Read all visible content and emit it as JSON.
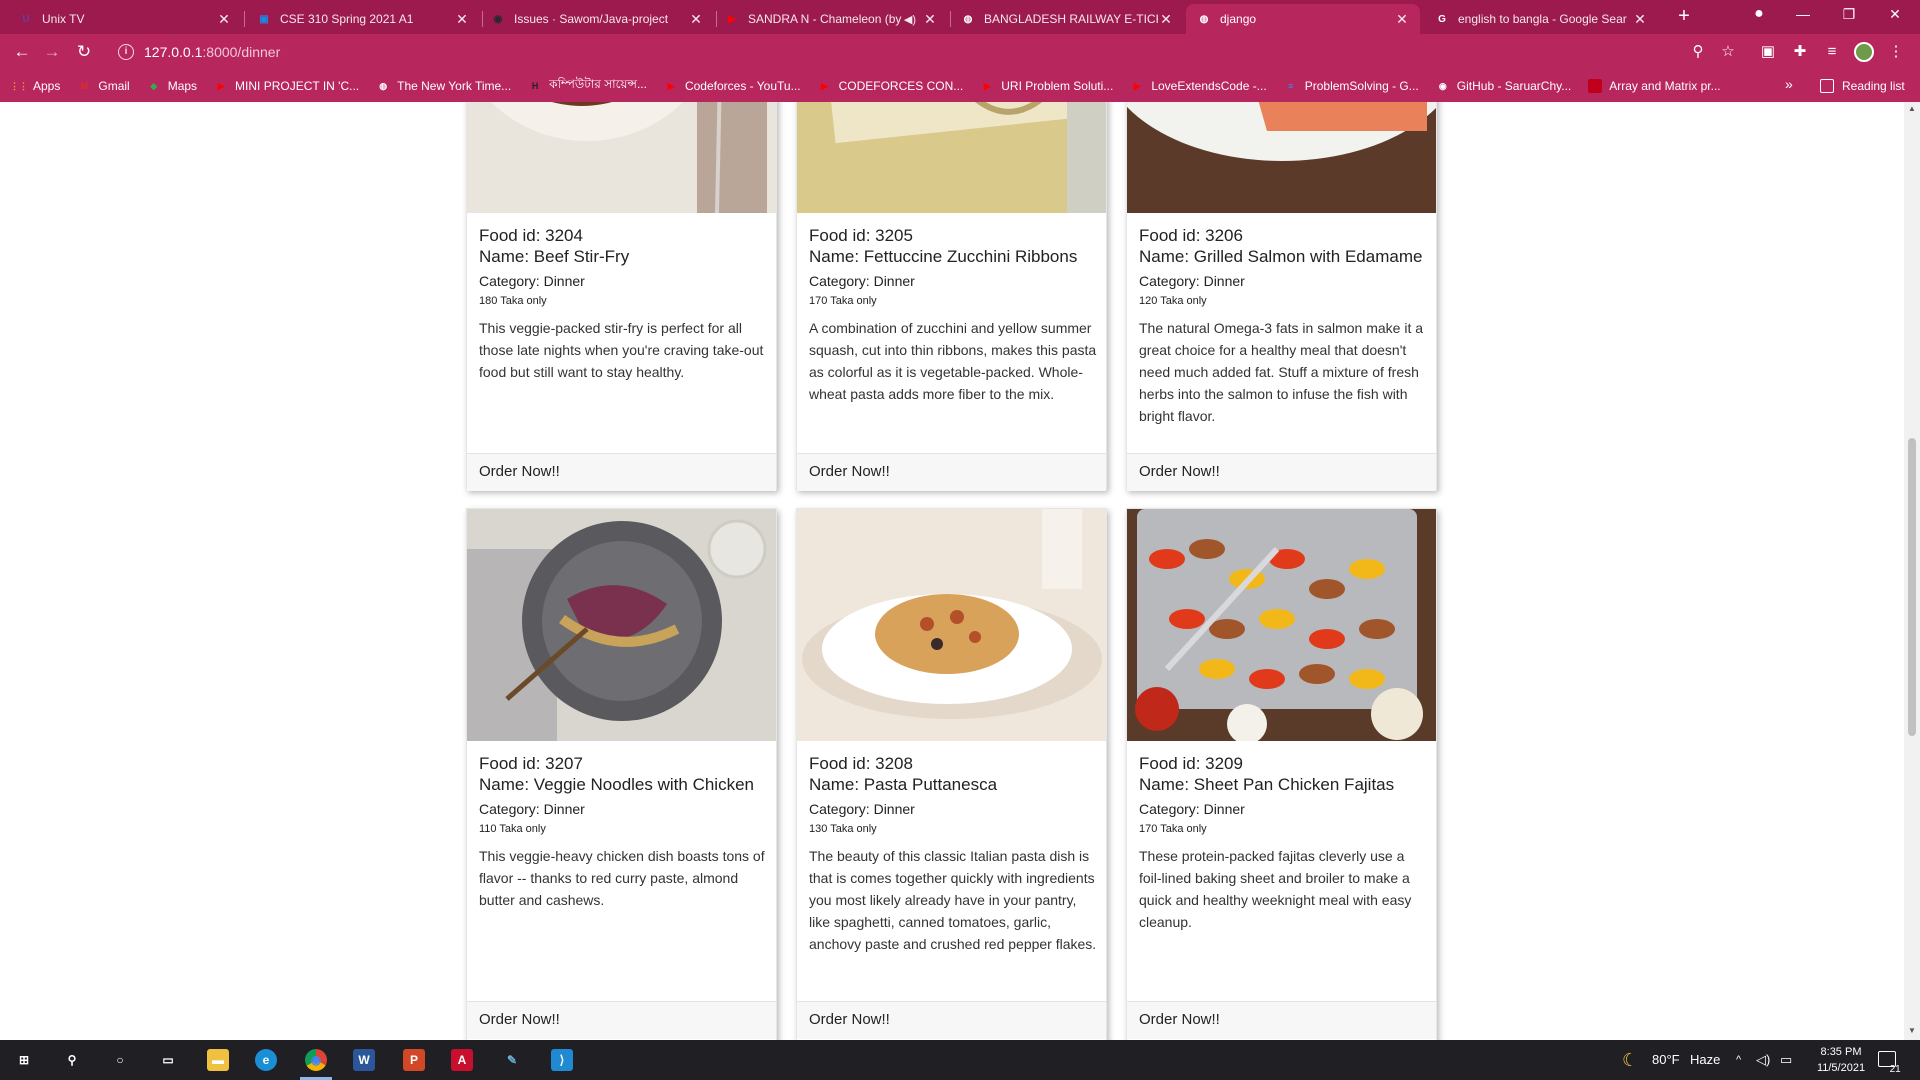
{
  "browser": {
    "tabs": [
      {
        "title": "Unix TV",
        "icon": "unix-tv-favicon",
        "icon_color": "#6a3ea1",
        "glyph": "U",
        "active": false
      },
      {
        "title": "CSE 310 Spring 2021 A1",
        "icon": "classroom-favicon",
        "icon_color": "#1e88e5",
        "glyph": "▣",
        "active": false
      },
      {
        "title": "Issues · Sawom/Java-project",
        "icon": "github-favicon",
        "icon_color": "#24292e",
        "glyph": "◉",
        "active": false
      },
      {
        "title": "SANDRA N - Chameleon (by",
        "icon": "youtube-favicon",
        "icon_color": "#ff0000",
        "glyph": "▶",
        "active": false,
        "audio": true
      },
      {
        "title": "BANGLADESH RAILWAY E-TICKE",
        "icon": "globe-favicon",
        "icon_color": "#ffffff",
        "glyph": "◍",
        "active": false
      },
      {
        "title": "django",
        "icon": "globe-favicon",
        "icon_color": "#ffffff",
        "glyph": "◍",
        "active": true
      },
      {
        "title": "english to bangla - Google Sear",
        "icon": "google-favicon",
        "icon_color": "#ffffff",
        "glyph": "G",
        "active": false
      }
    ],
    "url_host": "127.0.0.1",
    "url_path": ":8000/dinner",
    "bookmarks": [
      {
        "label": "Apps",
        "icon": "apps-grid-icon",
        "color": "#f0a030",
        "glyph": "⋮⋮"
      },
      {
        "label": "Gmail",
        "icon": "gmail-icon",
        "color": "#d93025",
        "glyph": "M"
      },
      {
        "label": "Maps",
        "icon": "maps-icon",
        "color": "#34a853",
        "glyph": "◆"
      },
      {
        "label": "MINI PROJECT IN 'C...",
        "icon": "youtube-icon",
        "color": "#ff0000",
        "glyph": "▶"
      },
      {
        "label": "The New York Time...",
        "icon": "globe-icon",
        "color": "#ffffff",
        "glyph": "◍"
      },
      {
        "label": "কম্পিউটার সায়েন্স...",
        "icon": "bookmark-site-icon",
        "color": "#222222",
        "glyph": "H"
      },
      {
        "label": "Codeforces - YouTu...",
        "icon": "youtube-icon",
        "color": "#ff0000",
        "glyph": "▶"
      },
      {
        "label": "CODEFORCES CON...",
        "icon": "youtube-icon",
        "color": "#ff0000",
        "glyph": "▶"
      },
      {
        "label": "URI Problem Soluti...",
        "icon": "youtube-icon",
        "color": "#ff0000",
        "glyph": "▶"
      },
      {
        "label": "LoveExtendsCode -...",
        "icon": "youtube-icon",
        "color": "#ff0000",
        "glyph": "▶"
      },
      {
        "label": "ProblemSolving - G...",
        "icon": "google-docs-icon",
        "color": "#4285f4",
        "glyph": "≡"
      },
      {
        "label": "GitHub - SaruarChy...",
        "icon": "github-icon",
        "color": "#ffffff",
        "glyph": "◉"
      },
      {
        "label": "Array and Matrix pr...",
        "icon": "folder-icon",
        "color": "#c0001a",
        "glyph": ""
      }
    ],
    "more_label": "»",
    "reading_list": "Reading list"
  },
  "foods": [
    {
      "id_text": "Food id: 3204",
      "name_text": "Name: Beef Stir-Fry",
      "category_text": "Category: Dinner",
      "price_text": "180 Taka only",
      "description": "This veggie-packed stir-fry is perfect for all those late nights when you're craving take-out food but still want to stay healthy.",
      "order_label": "Order Now!!",
      "photo": "beef-stir-fry-photo",
      "colors": [
        "#6b3a22",
        "#d23a1f",
        "#3f7d2a",
        "#e8c45a"
      ]
    },
    {
      "id_text": "Food id: 3205",
      "name_text": "Name: Fettuccine Zucchini Ribbons",
      "category_text": "Category: Dinner",
      "price_text": "170 Taka only",
      "description": "A combination of zucchini and yellow summer squash, cut into thin ribbons, makes this pasta as colorful as it is vegetable-packed. Whole-wheat pasta adds more fiber to the mix.",
      "order_label": "Order Now!!",
      "photo": "zucchini-pasta-photo",
      "colors": [
        "#d9c98a",
        "#7a9a3a",
        "#efe6c8",
        "#b8a46a"
      ]
    },
    {
      "id_text": "Food id: 3206",
      "name_text": "Name: Grilled Salmon with Edamame",
      "category_text": "Category: Dinner",
      "price_text": "120 Taka only",
      "description": "The natural Omega-3 fats in salmon make it a great choice for a healthy meal that doesn't need much added fat. Stuff a mixture of fresh herbs into the salmon to infuse the fish with bright flavor.",
      "order_label": "Order Now!!",
      "photo": "grilled-salmon-photo",
      "colors": [
        "#5b3a2a",
        "#6fb13a",
        "#e9825a",
        "#f2f2ee"
      ]
    },
    {
      "id_text": "Food id: 3207",
      "name_text": "Name: Veggie Noodles with Chicken",
      "category_text": "Category: Dinner",
      "price_text": "110 Taka only",
      "description": "This veggie-heavy chicken dish boasts tons of flavor -- thanks to red curry paste, almond butter and cashews.",
      "order_label": "Order Now!!",
      "photo": "veggie-noodles-photo",
      "colors": [
        "#d9d6d0",
        "#5a5a5e",
        "#7a2a4a",
        "#c9a35a"
      ]
    },
    {
      "id_text": "Food id: 3208",
      "name_text": "Name: Pasta Puttanesca",
      "category_text": "Category: Dinner",
      "price_text": "130 Taka only",
      "description": "The beauty of this classic Italian pasta dish is that is comes together quickly with ingredients you most likely already have in your pantry, like spaghetti, canned tomatoes, garlic, anchovy paste and crushed red pepper flakes.",
      "order_label": "Order Now!!",
      "photo": "pasta-puttanesca-photo",
      "colors": [
        "#efe7dc",
        "#ffffff",
        "#b3502a",
        "#d8a25a"
      ]
    },
    {
      "id_text": "Food id: 3209",
      "name_text": "Name: Sheet Pan Chicken Fajitas",
      "category_text": "Category: Dinner",
      "price_text": "170 Taka only",
      "description": "These protein-packed fajitas cleverly use a foil-lined baking sheet and broiler to make a quick and healthy weeknight meal with easy cleanup.",
      "order_label": "Order Now!!",
      "photo": "chicken-fajitas-photo",
      "colors": [
        "#b8b9bd",
        "#a0552a",
        "#e03a1a",
        "#f2b81a"
      ]
    }
  ],
  "taskbar": {
    "apps": [
      {
        "name": "windows-start-icon",
        "color": "#ffffff",
        "glyph": "⊞"
      },
      {
        "name": "search-icon",
        "color": "#ffffff",
        "glyph": "⚲"
      },
      {
        "name": "cortana-icon",
        "color": "#ffffff",
        "glyph": "○"
      },
      {
        "name": "task-view-icon",
        "color": "#ffffff",
        "glyph": "▭"
      },
      {
        "name": "file-explorer-icon",
        "color": "#f0c040",
        "glyph": "▬"
      },
      {
        "name": "edge-icon",
        "color": "#1a8fd6",
        "glyph": "e"
      },
      {
        "name": "chrome-icon",
        "color": "#e7b51a",
        "glyph": "◉"
      },
      {
        "name": "word-icon",
        "color": "#2b579a",
        "glyph": "W"
      },
      {
        "name": "powerpoint-icon",
        "color": "#d24726",
        "glyph": "P"
      },
      {
        "name": "acrobat-icon",
        "color": "#c8102e",
        "glyph": "A"
      },
      {
        "name": "notepad-icon",
        "color": "#6ab0d8",
        "glyph": "✎"
      },
      {
        "name": "vscode-icon",
        "color": "#1f8ad2",
        "glyph": "⟩"
      }
    ],
    "weather_temp": "80°F",
    "weather_desc": "Haze",
    "time": "8:35 PM",
    "date": "11/5/2021",
    "notifications": "21"
  }
}
